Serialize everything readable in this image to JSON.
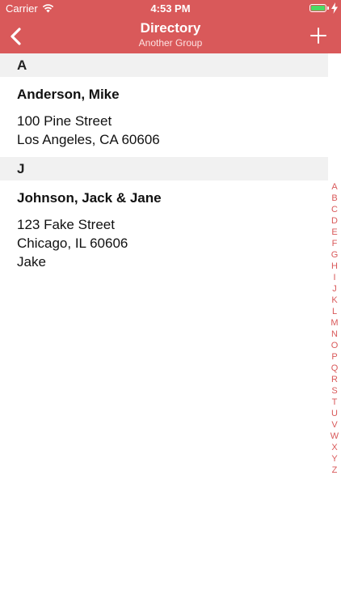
{
  "status_bar": {
    "carrier": "Carrier",
    "time": "4:53 PM",
    "battery_color": "#4cd964"
  },
  "nav": {
    "title": "Directory",
    "subtitle": "Another Group",
    "back_icon": "chevron-left-icon",
    "add_icon": "plus-icon",
    "accent": "#d9595a"
  },
  "sections": [
    {
      "letter": "A",
      "entries": [
        {
          "name": "Anderson, Mike",
          "lines": [
            "100 Pine Street",
            "Los Angeles, CA 60606"
          ]
        }
      ]
    },
    {
      "letter": "J",
      "entries": [
        {
          "name": "Johnson, Jack & Jane",
          "lines": [
            "123 Fake Street",
            "Chicago, IL 60606",
            "Jake"
          ]
        }
      ]
    }
  ],
  "index_letters": [
    "A",
    "B",
    "C",
    "D",
    "E",
    "F",
    "G",
    "H",
    "I",
    "J",
    "K",
    "L",
    "M",
    "N",
    "O",
    "P",
    "Q",
    "R",
    "S",
    "T",
    "U",
    "V",
    "W",
    "X",
    "Y",
    "Z"
  ]
}
